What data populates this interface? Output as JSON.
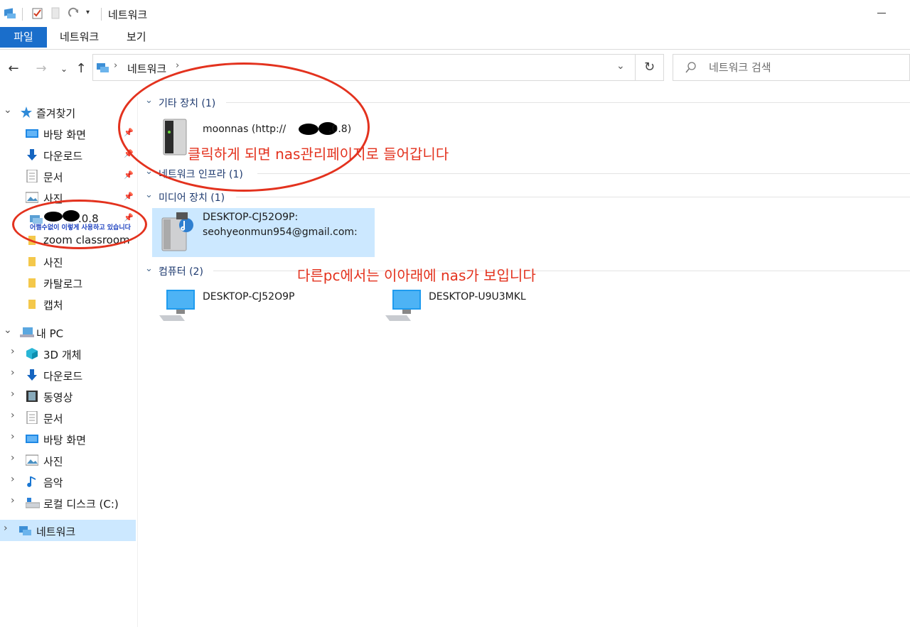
{
  "window": {
    "title": "네트워크",
    "minimize_icon": "minimize-icon"
  },
  "ribbon": {
    "tabs": [
      {
        "label": "파일"
      },
      {
        "label": "네트워크"
      },
      {
        "label": "보기"
      }
    ]
  },
  "address": {
    "breadcrumb": [
      "네트워크"
    ],
    "search_placeholder": "네트워크 검색"
  },
  "nav": {
    "quick_access": {
      "label": "즐겨찾기",
      "items": [
        {
          "label": "바탕 화면",
          "icon": "desktop-icon",
          "pinned": true
        },
        {
          "label": "다운로드",
          "icon": "download-icon",
          "pinned": true
        },
        {
          "label": "문서",
          "icon": "document-icon",
          "pinned": true
        },
        {
          "label": "사진",
          "icon": "pictures-icon",
          "pinned": true
        },
        {
          "label": ".0.8",
          "icon": "network-drive-icon",
          "pinned": true
        },
        {
          "label": "zoom classroom",
          "icon": "folder-icon",
          "pinned": false
        },
        {
          "label": "사진",
          "icon": "folder-icon",
          "pinned": false
        },
        {
          "label": "카탈로그",
          "icon": "folder-icon",
          "pinned": false
        },
        {
          "label": "캡처",
          "icon": "folder-icon",
          "pinned": false
        }
      ]
    },
    "this_pc": {
      "label": "내 PC",
      "items": [
        {
          "label": "3D 개체",
          "icon": "3d-objects-icon"
        },
        {
          "label": "다운로드",
          "icon": "download-icon"
        },
        {
          "label": "동영상",
          "icon": "video-icon"
        },
        {
          "label": "문서",
          "icon": "document-icon"
        },
        {
          "label": "바탕 화면",
          "icon": "desktop-icon"
        },
        {
          "label": "사진",
          "icon": "pictures-icon"
        },
        {
          "label": "음악",
          "icon": "music-icon"
        },
        {
          "label": "로컬 디스크 (C:)",
          "icon": "local-disk-icon"
        }
      ]
    },
    "network": {
      "label": "네트워크"
    }
  },
  "groups": [
    {
      "title": "기타 장치 (1)",
      "items": [
        {
          "name": "moonnas (http://",
          "name_suffix": ".0.8)"
        }
      ]
    },
    {
      "title": "네트워크 인프라 (1)",
      "items": []
    },
    {
      "title": "미디어 장치 (1)",
      "items": [
        {
          "name": "DESKTOP-CJ52O9P:",
          "name2": "seohyeonmun954@gmail.com:"
        }
      ]
    },
    {
      "title": "컴퓨터 (2)",
      "items": [
        {
          "name": "DESKTOP-CJ52O9P"
        },
        {
          "name": "DESKTOP-U9U3MKL"
        }
      ]
    }
  ],
  "annotations": {
    "nas_click": "클릭하게 되면 nas관리페이지로 들어갑니다",
    "other_pc": "다른pc에서는 이아래에 nas가 보입니다",
    "sidebar_note": "어쩔수없이 이렇게 사용하고 있습니다"
  },
  "colors": {
    "accent": "#1a6ecb",
    "selection": "#cce8ff",
    "annotation": "#e3321e",
    "group_title": "#1e3a6f"
  }
}
